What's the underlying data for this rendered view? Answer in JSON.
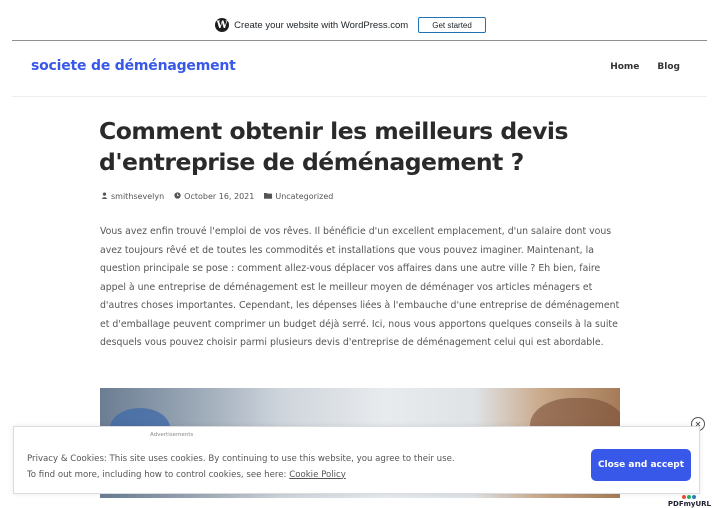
{
  "wp_banner": {
    "text": "Create your website with WordPress.com",
    "button_label": "Get started",
    "logo_glyph": "W"
  },
  "header": {
    "site_title": "societe de déménagement",
    "nav": [
      "Home",
      "Blog"
    ]
  },
  "post": {
    "title": "Comment obtenir les meilleurs devis d'entreprise de déménagement ?",
    "meta": {
      "author": "smithsevelyn",
      "date": "October 16, 2021",
      "category": "Uncategorized"
    },
    "body": "Vous avez enfin trouvé l'emploi de vos rêves. Il bénéficie d'un excellent emplacement, d'un salaire dont vous avez toujours rêvé et de toutes les commodités et installations que vous pouvez imaginer. Maintenant, la question principale se pose : comment allez-vous déplacer vos affaires dans une autre ville ? Eh bien, faire appel à une entreprise de déménagement est le meilleur moyen de déménager vos articles ménagers et d'autres choses importantes. Cependant, les dépenses liées à l'embauche d'une entreprise de déménagement et d'emballage peuvent comprimer un budget déjà serré. Ici, nous vous apportons quelques conseils à la suite desquels vous pouvez choisir parmi plusieurs devis d'entreprise de déménagement celui qui est abordable."
  },
  "ads_label": "Advertisements",
  "cookie_banner": {
    "line1": "Privacy & Cookies: This site uses cookies. By continuing to use this website, you agree to their use.",
    "line2_prefix": "To find out more, including how to control cookies, see here: ",
    "policy_link": "Cookie Policy",
    "accept_button": "Close and accept",
    "close_glyph": "✕"
  },
  "badge": {
    "label": "PDFmyURL"
  },
  "colors": {
    "accent": "#3858e9",
    "wp_button_border": "#2271b1",
    "text": "#555555",
    "title": "#2a2a2a"
  },
  "icons": [
    "wordpress-logo-icon",
    "author-icon",
    "clock-icon",
    "folder-icon",
    "close-icon"
  ]
}
